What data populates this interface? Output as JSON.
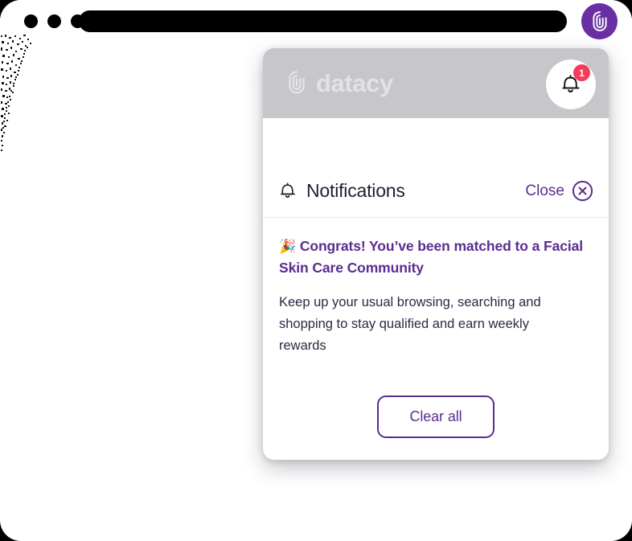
{
  "browser": {
    "window_dots_count": 3,
    "address_bar_value": "",
    "extension_icon": "datacy-fingerprint-icon",
    "extension_icon_color": "#6B2FA5"
  },
  "popup": {
    "brand": {
      "name": "datacy",
      "mark": "fingerprint-icon"
    },
    "bell": {
      "icon": "bell-icon",
      "badge_count": "1",
      "badge_color": "#F63B5B"
    },
    "notifications": {
      "title": "Notifications",
      "title_icon": "bell-icon",
      "close_label": "Close",
      "close_icon": "close-circle-icon",
      "items": [
        {
          "emoji": "🎉",
          "headline": "Congrats! You’ve been matched to a Facial Skin Care Community",
          "body": "Keep up your usual browsing, searching and shopping to stay qualified and earn weekly rewards"
        }
      ],
      "clear_all_label": "Clear all"
    }
  },
  "colors": {
    "brand_purple": "#5B2D90",
    "extension_purple": "#6B2FA5",
    "badge_red": "#F63B5B",
    "dim_gray": "#c6c6cb",
    "text_dark": "#2A2A44"
  }
}
